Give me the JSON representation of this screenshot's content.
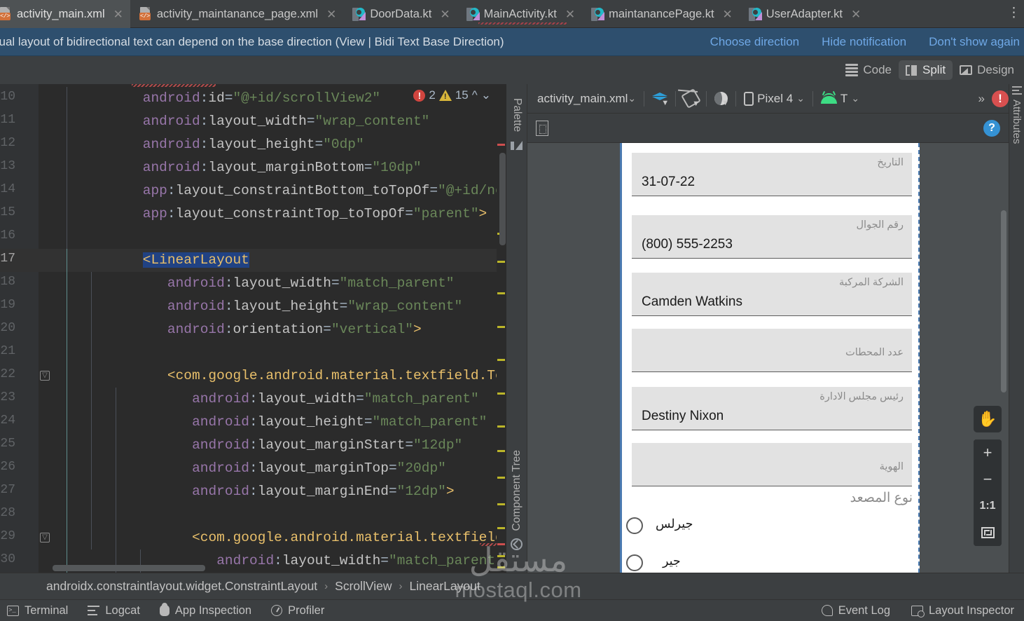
{
  "tabs": [
    {
      "label": "activity_main.xml",
      "icon": "xml-file-icon",
      "active": true,
      "error": false
    },
    {
      "label": "activity_maintanance_page.xml",
      "icon": "xml-file-icon",
      "active": false,
      "error": false
    },
    {
      "label": "DoorData.kt",
      "icon": "kotlin-file-icon",
      "active": false,
      "error": false
    },
    {
      "label": "MainActivity.kt",
      "icon": "kotlin-file-icon",
      "active": false,
      "error": true
    },
    {
      "label": "maintanancePage.kt",
      "icon": "kotlin-file-icon",
      "active": false,
      "error": false
    },
    {
      "label": "UserAdapter.kt",
      "icon": "kotlin-file-icon",
      "active": false,
      "error": false
    }
  ],
  "notification": {
    "message": "sual layout of bidirectional text can depend on the base direction (View | Bidi Text Base Direction)",
    "actions": [
      "Choose direction",
      "Hide notification",
      "Don't show again"
    ]
  },
  "editor_modes": [
    {
      "label": "Code",
      "icon": "code-lines-icon",
      "active": false
    },
    {
      "label": "Split",
      "icon": "split-view-icon",
      "active": true
    },
    {
      "label": "Design",
      "icon": "design-image-icon",
      "active": false
    }
  ],
  "editor": {
    "inspection": {
      "error_count": "2",
      "warning_count": "15"
    },
    "line_numbers": [
      "10",
      "11",
      "12",
      "13",
      "14",
      "15",
      "16",
      "17",
      "18",
      "19",
      "20",
      "21",
      "22",
      "23",
      "24",
      "25",
      "26",
      "27",
      "28",
      "29",
      "30"
    ],
    "current_line": "17",
    "lines": [
      {
        "indent": 8,
        "segments": [
          {
            "t": "android",
            "c": "attr"
          },
          {
            "t": ":",
            "c": "punct"
          },
          {
            "t": "id",
            "c": "name"
          },
          {
            "t": "=",
            "c": "punct"
          },
          {
            "t": "\"@+id/scrollView2\"",
            "c": "str"
          }
        ]
      },
      {
        "indent": 8,
        "segments": [
          {
            "t": "android",
            "c": "attr"
          },
          {
            "t": ":",
            "c": "punct"
          },
          {
            "t": "layout_width",
            "c": "name"
          },
          {
            "t": "=",
            "c": "punct"
          },
          {
            "t": "\"wrap_content\"",
            "c": "str"
          }
        ]
      },
      {
        "indent": 8,
        "segments": [
          {
            "t": "android",
            "c": "attr"
          },
          {
            "t": ":",
            "c": "punct"
          },
          {
            "t": "layout_height",
            "c": "name"
          },
          {
            "t": "=",
            "c": "punct"
          },
          {
            "t": "\"0dp\"",
            "c": "str"
          }
        ]
      },
      {
        "indent": 8,
        "segments": [
          {
            "t": "android",
            "c": "attr"
          },
          {
            "t": ":",
            "c": "punct"
          },
          {
            "t": "layout_marginBottom",
            "c": "name"
          },
          {
            "t": "=",
            "c": "punct"
          },
          {
            "t": "\"10dp\"",
            "c": "str"
          }
        ]
      },
      {
        "indent": 8,
        "segments": [
          {
            "t": "app",
            "c": "attr"
          },
          {
            "t": ":",
            "c": "punct"
          },
          {
            "t": "layout_constraintBottom_toTopOf",
            "c": "name"
          },
          {
            "t": "=",
            "c": "punct"
          },
          {
            "t": "\"@+id/next",
            "c": "str"
          }
        ]
      },
      {
        "indent": 8,
        "segments": [
          {
            "t": "app",
            "c": "attr"
          },
          {
            "t": ":",
            "c": "punct"
          },
          {
            "t": "layout_constraintTop_toTopOf",
            "c": "name"
          },
          {
            "t": "=",
            "c": "punct"
          },
          {
            "t": "\"parent\"",
            "c": "str"
          },
          {
            "t": ">",
            "c": "tag"
          }
        ]
      },
      {
        "indent": 0,
        "segments": []
      },
      {
        "indent": 8,
        "selected": true,
        "segments": [
          {
            "t": "<LinearLayout",
            "c": "tag"
          }
        ]
      },
      {
        "indent": 11,
        "segments": [
          {
            "t": "android",
            "c": "attr"
          },
          {
            "t": ":",
            "c": "punct"
          },
          {
            "t": "layout_width",
            "c": "name"
          },
          {
            "t": "=",
            "c": "punct"
          },
          {
            "t": "\"match_parent\"",
            "c": "str"
          }
        ]
      },
      {
        "indent": 11,
        "segments": [
          {
            "t": "android",
            "c": "attr"
          },
          {
            "t": ":",
            "c": "punct"
          },
          {
            "t": "layout_height",
            "c": "name"
          },
          {
            "t": "=",
            "c": "punct"
          },
          {
            "t": "\"wrap_content\"",
            "c": "str"
          }
        ]
      },
      {
        "indent": 11,
        "segments": [
          {
            "t": "android",
            "c": "attr"
          },
          {
            "t": ":",
            "c": "punct"
          },
          {
            "t": "orientation",
            "c": "name"
          },
          {
            "t": "=",
            "c": "punct"
          },
          {
            "t": "\"vertical\"",
            "c": "str"
          },
          {
            "t": ">",
            "c": "tag"
          }
        ]
      },
      {
        "indent": 0,
        "segments": []
      },
      {
        "indent": 11,
        "segments": [
          {
            "t": "<com.google.android.material.textfield.Tex",
            "c": "tag"
          }
        ]
      },
      {
        "indent": 14,
        "segments": [
          {
            "t": "android",
            "c": "attr"
          },
          {
            "t": ":",
            "c": "punct"
          },
          {
            "t": "layout_width",
            "c": "name"
          },
          {
            "t": "=",
            "c": "punct"
          },
          {
            "t": "\"match_parent\"",
            "c": "str"
          }
        ]
      },
      {
        "indent": 14,
        "segments": [
          {
            "t": "android",
            "c": "attr"
          },
          {
            "t": ":",
            "c": "punct"
          },
          {
            "t": "layout_height",
            "c": "name"
          },
          {
            "t": "=",
            "c": "punct"
          },
          {
            "t": "\"match_parent\"",
            "c": "str"
          }
        ]
      },
      {
        "indent": 14,
        "segments": [
          {
            "t": "android",
            "c": "attr"
          },
          {
            "t": ":",
            "c": "punct"
          },
          {
            "t": "layout_marginStart",
            "c": "name"
          },
          {
            "t": "=",
            "c": "punct"
          },
          {
            "t": "\"12dp\"",
            "c": "str"
          }
        ]
      },
      {
        "indent": 14,
        "segments": [
          {
            "t": "android",
            "c": "attr"
          },
          {
            "t": ":",
            "c": "punct"
          },
          {
            "t": "layout_marginTop",
            "c": "name"
          },
          {
            "t": "=",
            "c": "punct"
          },
          {
            "t": "\"20dp\"",
            "c": "str"
          }
        ]
      },
      {
        "indent": 14,
        "segments": [
          {
            "t": "android",
            "c": "attr"
          },
          {
            "t": ":",
            "c": "punct"
          },
          {
            "t": "layout_marginEnd",
            "c": "name"
          },
          {
            "t": "=",
            "c": "punct"
          },
          {
            "t": "\"12dp\"",
            "c": "str"
          },
          {
            "t": ">",
            "c": "tag"
          }
        ]
      },
      {
        "indent": 0,
        "segments": []
      },
      {
        "indent": 14,
        "segments": [
          {
            "t": "<com.google.android.material.textfield",
            "c": "tag"
          }
        ]
      },
      {
        "indent": 17,
        "segments": [
          {
            "t": "android",
            "c": "attr"
          },
          {
            "t": ":",
            "c": "punct"
          },
          {
            "t": "layout_width",
            "c": "name"
          },
          {
            "t": "=",
            "c": "punct"
          },
          {
            "t": "\"match_parent",
            "c": "str"
          }
        ]
      }
    ]
  },
  "design": {
    "left_tabs": [
      {
        "label": "Palette",
        "icon": "palette-icon"
      },
      {
        "label": "Component Tree",
        "icon": "component-tree-icon"
      }
    ],
    "right_tab": {
      "label": "Attributes",
      "icon": "attributes-icon"
    },
    "toolbar": {
      "file": "activity_main.xml",
      "layers_icon": "layers-icon",
      "orientation_icon": "rotate-orientation-icon",
      "theme_icon": "theme-mode-icon",
      "device": "Pixel 4",
      "device_icon": "phone-icon",
      "locale": "T",
      "locale_icon": "android-robot-icon",
      "overflow_icon": "chevron-right-right-icon",
      "issues_icon": "error-notification-icon"
    },
    "subbar": {
      "constraints_icon": "view-constraints-icon",
      "help_icon": "help-question-icon"
    },
    "zoom_controls": [
      {
        "label": "",
        "icon": "pan-hand-icon",
        "name": "pan-tool-button"
      },
      {
        "label": "+",
        "icon": "zoom-in-icon",
        "name": "zoom-in-button"
      },
      {
        "label": "−",
        "icon": "zoom-out-icon",
        "name": "zoom-out-button"
      },
      {
        "label": "1:1",
        "icon": "zoom-actual-size-icon",
        "name": "zoom-actual-button"
      },
      {
        "label": "",
        "icon": "zoom-fit-icon",
        "name": "zoom-fit-button"
      }
    ]
  },
  "preview": {
    "fields": [
      {
        "label": "التاريخ",
        "value": "31-07-22"
      },
      {
        "label": "رقم الجوال",
        "value": "(800) 555-2253"
      },
      {
        "label": "الشركة المركبة",
        "value": "Camden Watkins"
      },
      {
        "label": "عدد المحطات",
        "value": ""
      },
      {
        "label": "رئيس مجلس الادارة",
        "value": "Destiny Nixon"
      },
      {
        "label": "الهوية",
        "value": ""
      }
    ],
    "radio_group": {
      "label": "نوع المصعد",
      "options": [
        {
          "label": "جيرلس",
          "selected": false
        },
        {
          "label": "جير",
          "selected": false
        }
      ]
    }
  },
  "breadcrumb": [
    "androidx.constraintlayout.widget.ConstraintLayout",
    "ScrollView",
    "LinearLayout"
  ],
  "statusbar": {
    "left": [
      {
        "label": "Terminal",
        "icon": "terminal-icon"
      },
      {
        "label": "Logcat",
        "icon": "logcat-icon"
      },
      {
        "label": "App Inspection",
        "icon": "app-inspection-icon"
      },
      {
        "label": "Profiler",
        "icon": "profiler-icon"
      }
    ],
    "right": [
      {
        "label": "Event Log",
        "icon": "event-log-icon"
      },
      {
        "label": "Layout Inspector",
        "icon": "layout-inspector-icon"
      }
    ]
  },
  "watermark": {
    "arabic": "مستقل",
    "latin": "mostaql.com"
  },
  "colors": {
    "accent_blue": "#3592d4",
    "notification_bg": "#2e4f6e",
    "editor_bg": "#2b2b2b",
    "chrome_bg": "#3c3f41",
    "error_red": "#d85050",
    "warning_yellow": "#d8b63a",
    "kotlin_teal": "#23b8c8",
    "xml_orange": "#d2713a",
    "android_green": "#3ddc84"
  }
}
